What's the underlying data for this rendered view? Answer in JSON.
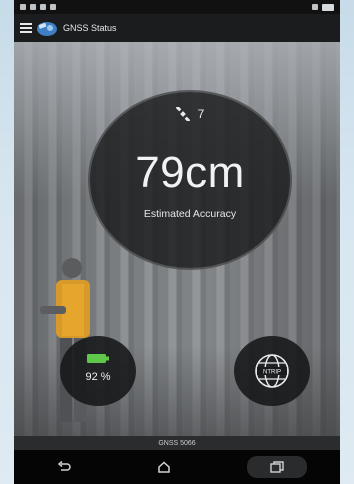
{
  "appbar": {
    "title": "GNSS Status",
    "menu_icon": "hamburger-menu-icon",
    "logo_icon": "gnss-satellite-logo-icon"
  },
  "accuracy": {
    "satellite_icon": "satellite-icon",
    "satellite_count": "7",
    "value": "79cm",
    "label": "Estimated Accuracy"
  },
  "battery": {
    "icon": "battery-icon",
    "percent": "92 %",
    "color": "#5fc74a"
  },
  "ntrip": {
    "icon": "globe-ntrip-icon",
    "label": "NTRIP"
  },
  "device_bar": {
    "label": "GNSS 5066"
  },
  "navbar": {
    "back_icon": "back-icon",
    "home_icon": "home-icon",
    "recents_icon": "recent-apps-icon"
  }
}
